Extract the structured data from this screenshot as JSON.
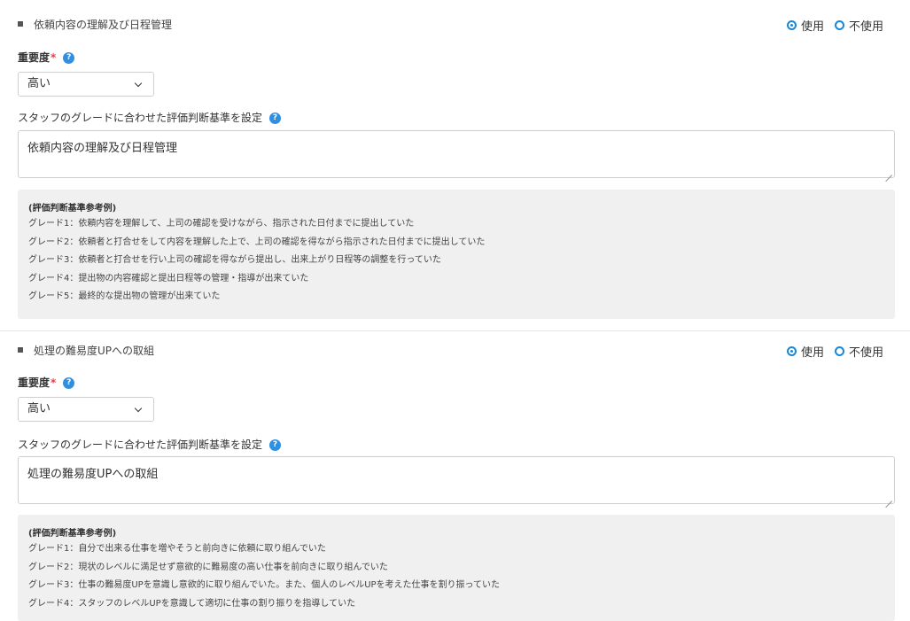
{
  "sections": [
    {
      "title": "依頼内容の理解及び日程管理",
      "radio_use": "使用",
      "radio_not_use": "不使用",
      "importance_label": "重要度",
      "required_mark": "*",
      "importance_value": "高い",
      "criteria_label": "スタッフのグレードに合わせた評価判断基準を設定",
      "criteria_value": "依頼内容の理解及び日程管理",
      "reference_title": "(評価判断基準参考例)",
      "reference_lines": [
        "グレード1：依頼内容を理解して、上司の確認を受けながら、指示された日付までに提出していた",
        "グレード2：依頼者と打合せをして内容を理解した上で、上司の確認を得ながら指示された日付までに提出していた",
        "グレード3：依頼者と打合せを行い上司の確認を得ながら提出し、出来上がり日程等の調整を行っていた",
        "グレード4：提出物の内容確認と提出日程等の管理・指導が出来ていた",
        "グレード5：最終的な提出物の管理が出来ていた"
      ]
    },
    {
      "title": "処理の難易度UPへの取組",
      "radio_use": "使用",
      "radio_not_use": "不使用",
      "importance_label": "重要度",
      "required_mark": "*",
      "importance_value": "高い",
      "criteria_label": "スタッフのグレードに合わせた評価判断基準を設定",
      "criteria_value": "処理の難易度UPへの取組",
      "reference_title": "(評価判断基準参考例)",
      "reference_lines": [
        "グレード1：自分で出来る仕事を増やそうと前向きに依頼に取り組んでいた",
        "グレード2：現状のレベルに満足せず意欲的に難易度の高い仕事を前向きに取り組んでいた",
        "グレード3：仕事の難易度UPを意識し意欲的に取り組んでいた。また、個人のレベルUPを考えた仕事を割り振っていた",
        "グレード4：スタッフのレベルUPを意識して適切に仕事の割り振りを指導していた"
      ]
    }
  ],
  "help_glyph": "?",
  "colors": {
    "accent": "#1a86d6",
    "required": "#e0424b",
    "reference_bg": "#f0f0f0"
  }
}
